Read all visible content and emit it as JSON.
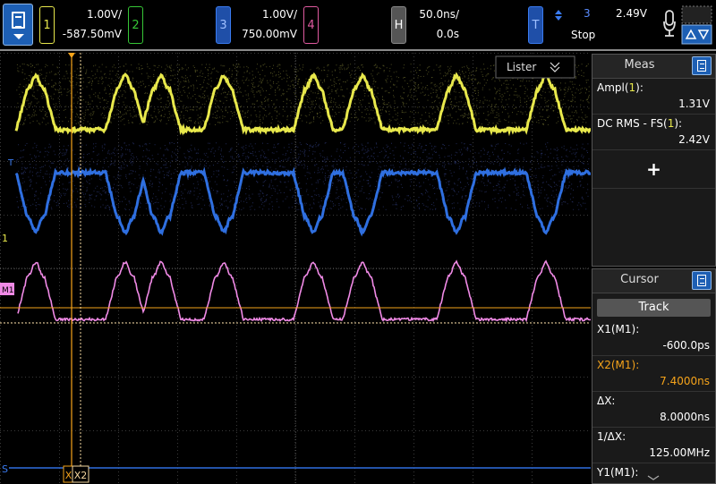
{
  "top_bar": {
    "channels": [
      {
        "number": "1",
        "scale": "1.00V/",
        "offset": "-587.50mV",
        "color": "#e8e84c"
      },
      {
        "number": "2",
        "scale": "",
        "offset": "",
        "color": "#36c636"
      },
      {
        "number": "3",
        "scale": "1.00V/",
        "offset": "750.00mV",
        "color": "#3a7bf0"
      },
      {
        "number": "4",
        "scale": "",
        "offset": "",
        "color": "#e05aa0"
      }
    ],
    "horizontal": {
      "label": "H",
      "scale": "50.0ns/",
      "delay": "0.0s"
    },
    "trigger": {
      "label": "T",
      "source": "3",
      "level": "2.49V",
      "status": "Stop"
    }
  },
  "waveform": {
    "lister_label": "Lister",
    "cursor_x1_label": "X1",
    "cursor_x2_label": "X2",
    "ground_marker_1": "1",
    "ground_marker_m": "M1",
    "ground_marker_t": "T",
    "ground_marker_s": "S"
  },
  "meas_panel": {
    "title": "Meas",
    "items": [
      {
        "label_prefix": "Ampl(",
        "label_channel": "1",
        "label_suffix": "):",
        "value": "1.31V"
      },
      {
        "label_prefix": "DC RMS - FS(",
        "label_channel": "1",
        "label_suffix": "):",
        "value": "2.42V"
      }
    ],
    "add_label": "+"
  },
  "cursor_panel": {
    "title": "Cursor",
    "mode_button": "Track",
    "rows": [
      {
        "label": "X1(M1):",
        "value": "-600.0ps",
        "color": "#ffffff"
      },
      {
        "label": "X2(M1):",
        "value": "7.4000ns",
        "color": "#f5a31a"
      },
      {
        "label": "ΔX:",
        "value": "8.0000ns",
        "color": "#ffffff"
      },
      {
        "label": "1/ΔX:",
        "value": "125.00MHz",
        "color": "#ffffff"
      },
      {
        "label": "Y1(M1):",
        "value": "",
        "color": "#ffffff"
      }
    ]
  },
  "colors": {
    "ch1": "#e8e84c",
    "ch3": "#3a7bf0",
    "math": "#f08ae6",
    "cursor": "#f5a31a",
    "accent": "#1d5fb4"
  }
}
